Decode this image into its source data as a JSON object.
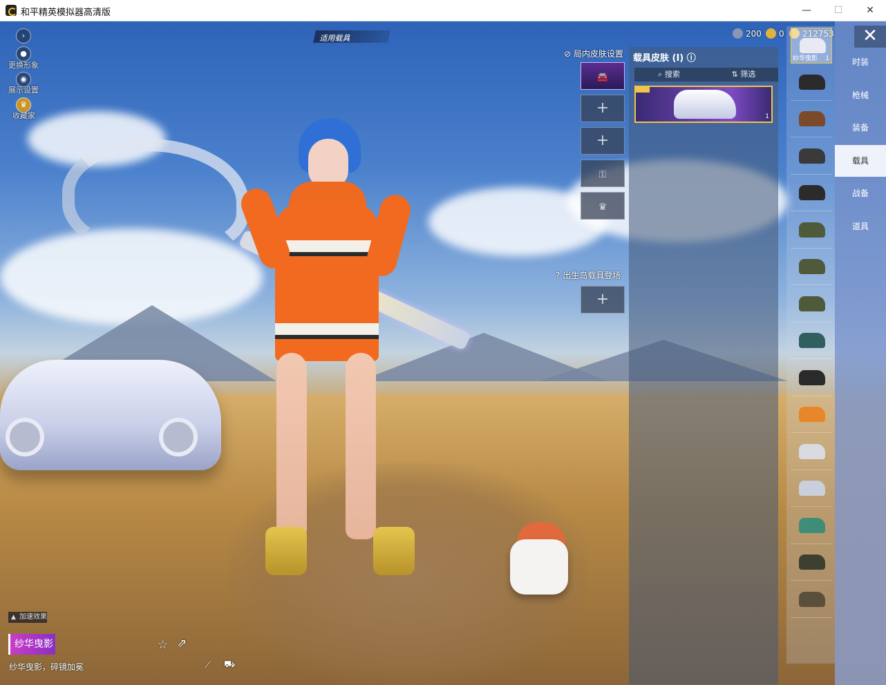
{
  "window": {
    "title": "和平精英模拟器高清版",
    "min_icon": "minimize-icon",
    "max_icon": "maximize-icon",
    "close_icon": "close-icon"
  },
  "left_tools": [
    {
      "label": "更换形象",
      "icon": "avatar-icon"
    },
    {
      "label": "展示设置",
      "icon": "eye-icon"
    },
    {
      "label": "收藏家",
      "icon": "collector-badge-icon"
    }
  ],
  "expand_icon": "expand-arrow-icon",
  "applied_vehicle": {
    "label": "适用载具"
  },
  "currency": [
    {
      "icon": "silver-coin-icon",
      "value": "200",
      "color": "#8a96b5"
    },
    {
      "icon": "gold-badge-icon",
      "value": "0",
      "color": "#e0b33b"
    },
    {
      "icon": "gold-coin-icon",
      "value": "212753",
      "color": "#f1c548"
    }
  ],
  "skin_slots": {
    "header": "局内皮肤设置",
    "spawn_label": "出生岛载具登场"
  },
  "skin_panel": {
    "title": "载具皮肤 (I)",
    "search": "搜索",
    "filter": "筛选",
    "card_count": "1"
  },
  "vehicle_list": [
    {
      "label": "纱华曳影",
      "count": "1",
      "color": "#e8e9f3"
    },
    {
      "label": "",
      "count": "",
      "color": "#2a2a2a"
    },
    {
      "label": "",
      "count": "",
      "color": "#7a4a2a"
    },
    {
      "label": "",
      "count": "",
      "color": "#3a3a3a"
    },
    {
      "label": "",
      "count": "",
      "color": "#2b2b2b"
    },
    {
      "label": "",
      "count": "",
      "color": "#4f5a3a"
    },
    {
      "label": "",
      "count": "",
      "color": "#4f5a3a"
    },
    {
      "label": "",
      "count": "",
      "color": "#4f5a3a"
    },
    {
      "label": "",
      "count": "",
      "color": "#2f5f5f"
    },
    {
      "label": "",
      "count": "",
      "color": "#2a2a2a"
    },
    {
      "label": "",
      "count": "",
      "color": "#e8862a"
    },
    {
      "label": "",
      "count": "",
      "color": "#d9dbe0"
    },
    {
      "label": "",
      "count": "",
      "color": "#c9d0dc"
    },
    {
      "label": "",
      "count": "",
      "color": "#3f8c78"
    },
    {
      "label": "",
      "count": "",
      "color": "#3d4030"
    },
    {
      "label": "",
      "count": "",
      "color": "#5a4f3a"
    }
  ],
  "categories": [
    {
      "label": "时装",
      "active": false
    },
    {
      "label": "枪械",
      "active": false
    },
    {
      "label": "装备",
      "active": false
    },
    {
      "label": "载具",
      "active": true
    },
    {
      "label": "战备",
      "active": false
    },
    {
      "label": "道具",
      "active": false
    }
  ],
  "bottom": {
    "accel_badge": "加速效果",
    "skin_name": "纱华曳影",
    "skin_desc": "纱华曳影，碎镜加冕",
    "icons": [
      "star-icon",
      "share-icon",
      "horn-icon",
      "car-icon"
    ]
  }
}
